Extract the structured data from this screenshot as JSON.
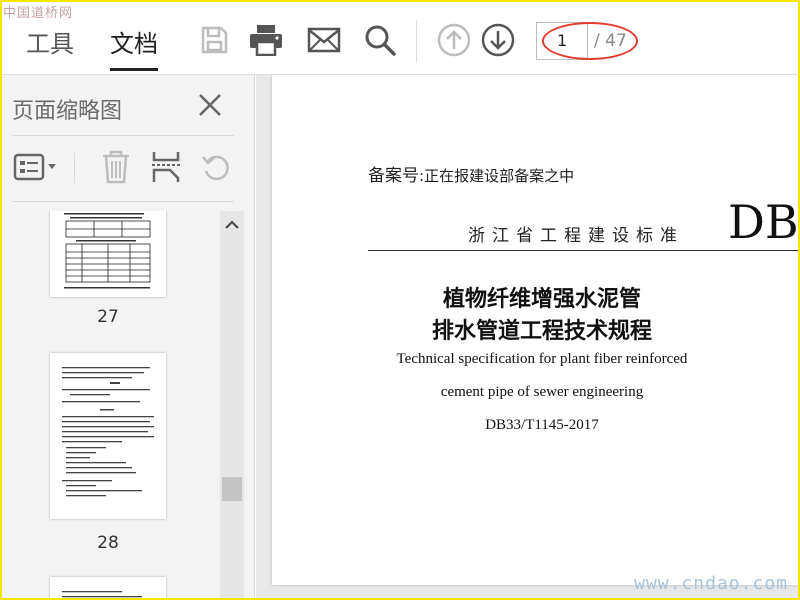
{
  "toolbar": {
    "tabs": [
      {
        "label": "工具"
      },
      {
        "label": "文档",
        "active": true
      }
    ],
    "buttons": {
      "save": "save-icon",
      "print": "printer-icon",
      "email": "envelope-icon",
      "search": "search-icon",
      "prev": "arrow-up-circle-icon",
      "next": "arrow-down-circle-icon"
    },
    "page_current": "1",
    "page_total": "/ 47"
  },
  "sidebar": {
    "title": "页面缩略图",
    "thumbnails": [
      {
        "label": "27"
      },
      {
        "label": "28"
      },
      {
        "label": ""
      }
    ]
  },
  "document": {
    "record_label": "备案号",
    "record_value": "正在报建设部备案之中",
    "standard_type": "浙江省工程建设标准",
    "logo_text": "DB",
    "title_cn_line1": "植物纤维增强水泥管",
    "title_cn_line2": "排水管道工程技术规程",
    "title_en_line1": "Technical specification for plant fiber reinforced",
    "title_en_line2": "cement pipe of sewer engineering",
    "code": "DB33/T1145-2017"
  },
  "watermarks": {
    "top_left": "中国道桥网",
    "bottom_right": "www.cndao.com"
  },
  "colors": {
    "border": "#f5e600",
    "highlight": "#e23a2e",
    "icon": "#555555",
    "icon_disabled": "#bdbdbd"
  }
}
